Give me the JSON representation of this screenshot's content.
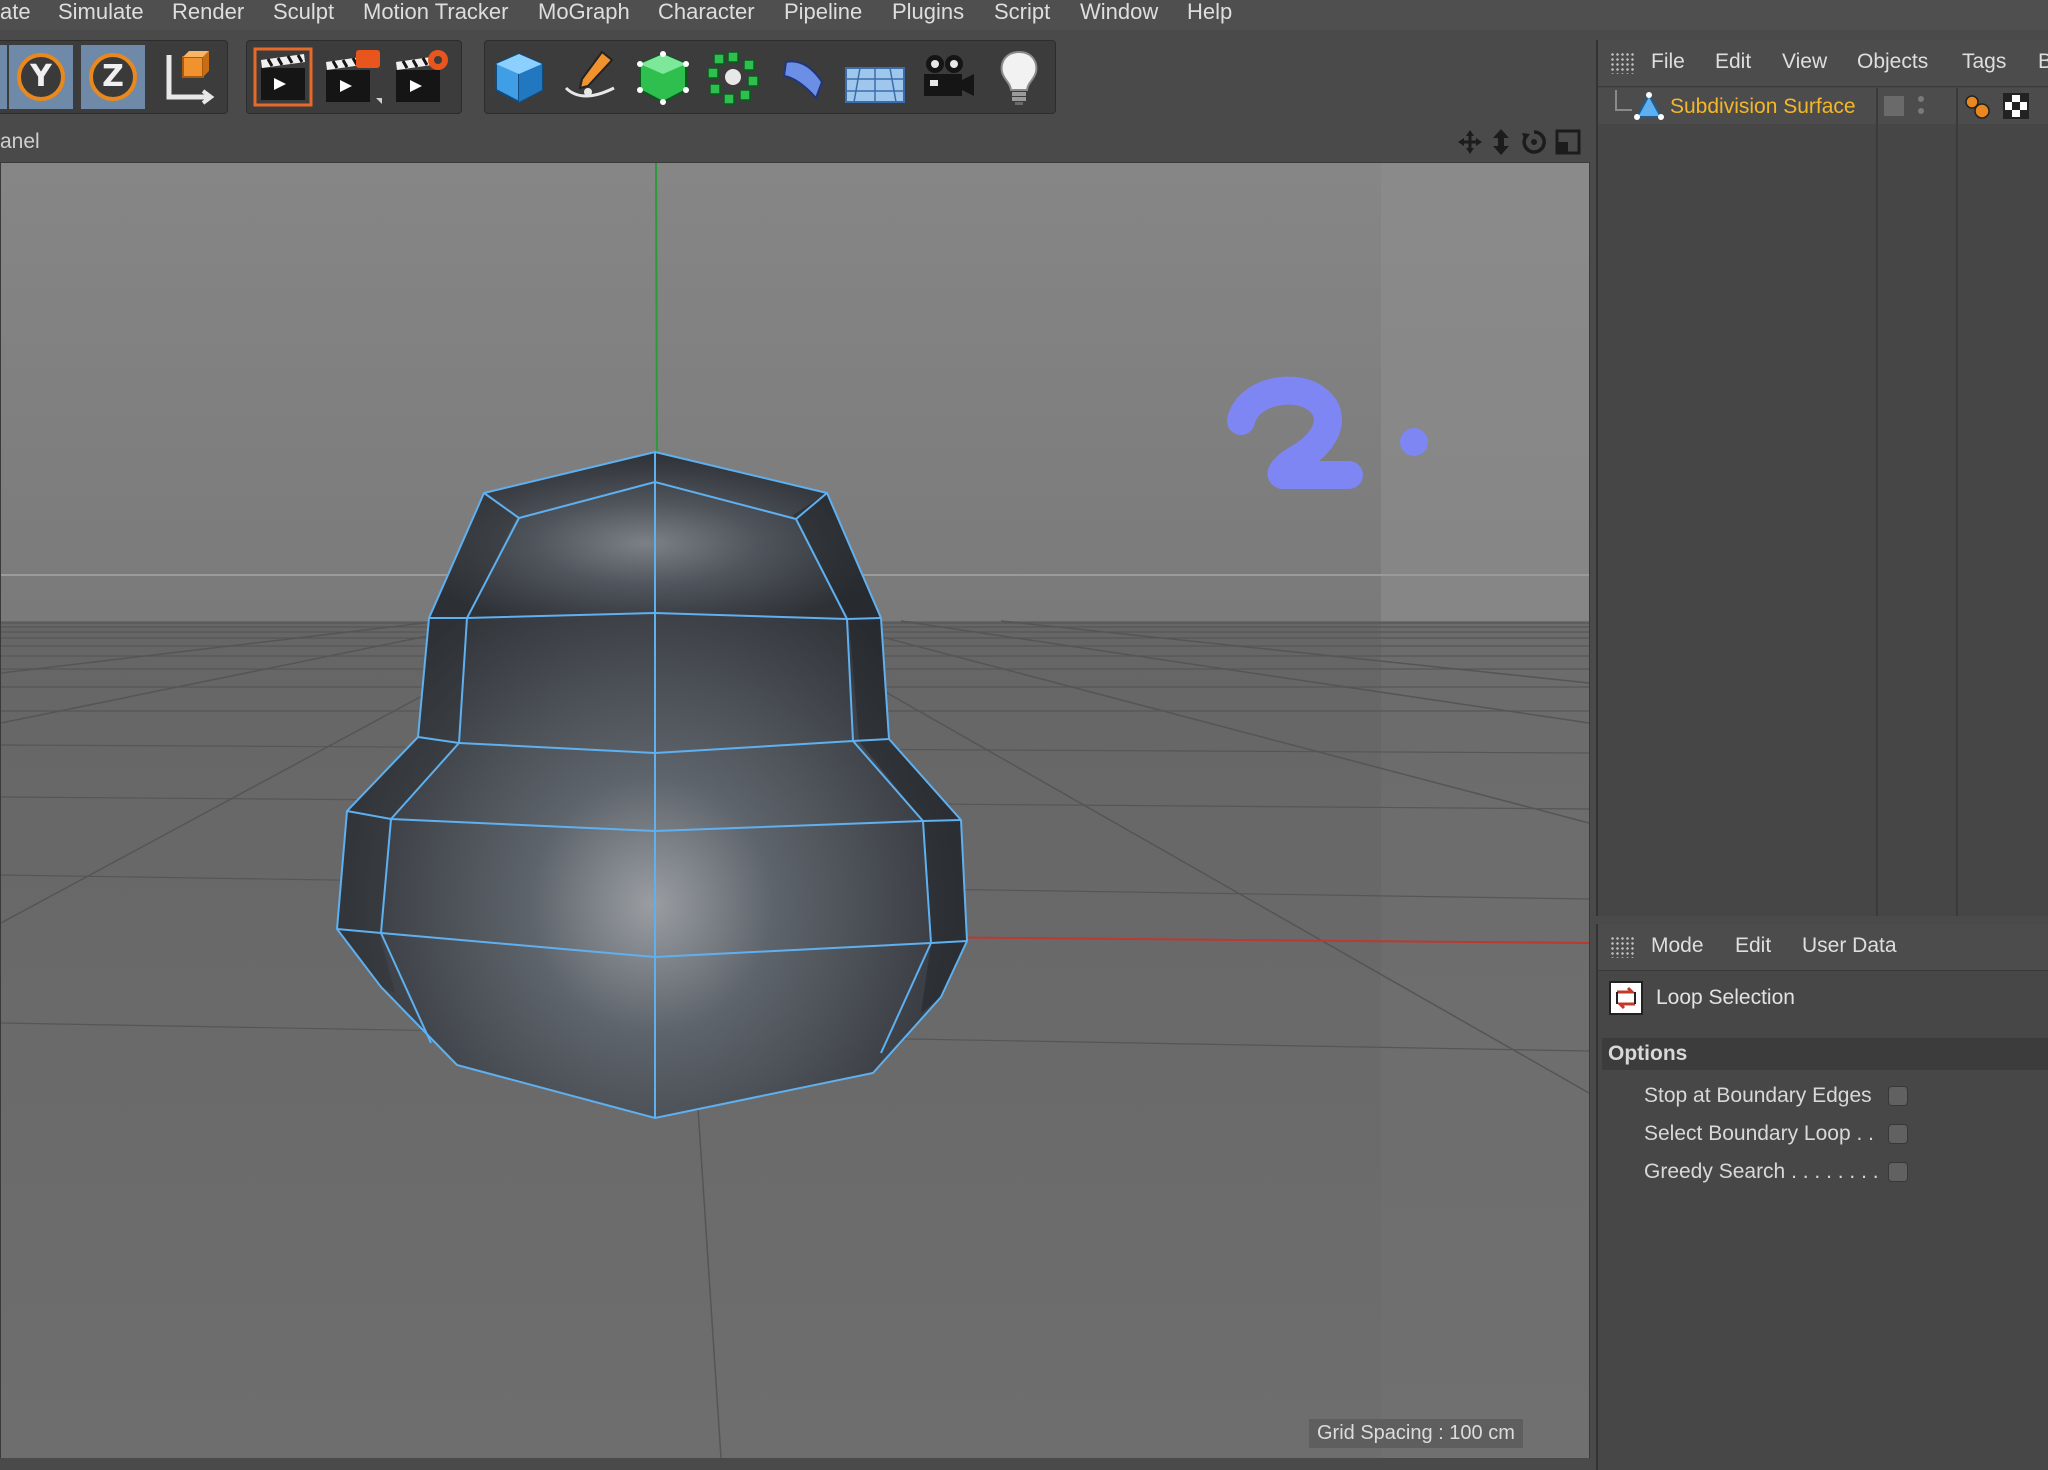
{
  "menubar": {
    "items": [
      "ate",
      "Simulate",
      "Render",
      "Sculpt",
      "Motion Tracker",
      "MoGraph",
      "Character",
      "Pipeline",
      "Plugins",
      "Script",
      "Window",
      "Help"
    ]
  },
  "toolbar": {
    "axis_y": "Y",
    "axis_z": "Z"
  },
  "viewport": {
    "title": "anel",
    "grid_spacing": "Grid Spacing : 100 cm",
    "annotation": "2."
  },
  "object_manager": {
    "menu": [
      "File",
      "Edit",
      "View",
      "Objects",
      "Tags",
      "B"
    ],
    "object_name": "Subdivision Surface"
  },
  "attribute_manager": {
    "menu": [
      "Mode",
      "Edit",
      "User Data"
    ],
    "tool_name": "Loop Selection",
    "section": "Options",
    "options": [
      {
        "label": "Stop at Boundary Edges"
      },
      {
        "label": "Select Boundary Loop . ."
      },
      {
        "label": "Greedy Search . . . . . . . ."
      }
    ]
  },
  "colors": {
    "accent_selection": "#f5b728",
    "edge_highlight": "#5fb0f0",
    "annotation": "#7e86f4",
    "axis_x": "#c23b2f",
    "axis_y": "#3aa14a"
  }
}
